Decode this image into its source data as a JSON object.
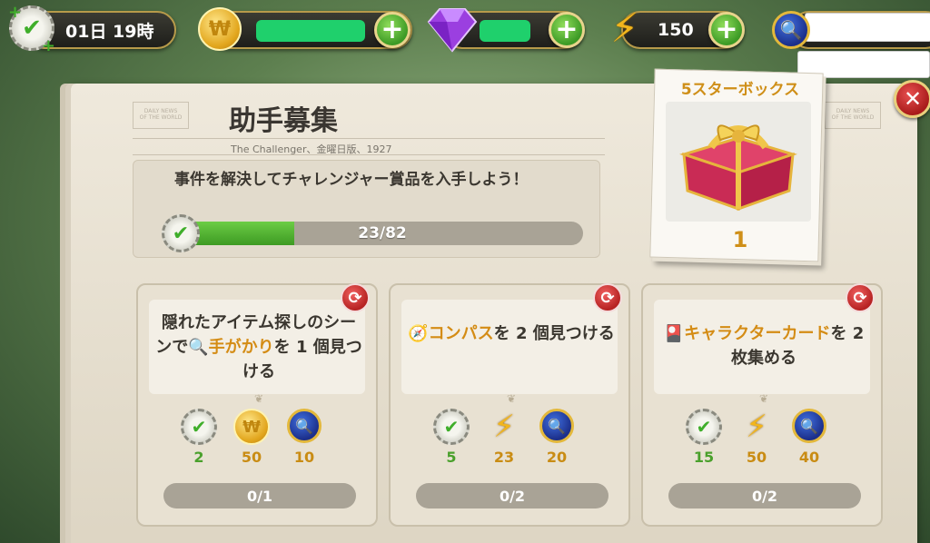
{
  "hud": {
    "timer": "01日 19時",
    "energy": "150",
    "plus_symbol": "+"
  },
  "panel": {
    "title": "助手募集",
    "subtitle": "The Challenger、金曜日版、1927",
    "close_symbol": "✕"
  },
  "progress": {
    "description": "事件を解決してチャレンジャー賞品を入手しよう！",
    "current": 23,
    "total": 82,
    "label": "23/82"
  },
  "reward_box": {
    "title": "5スターボックス",
    "count": "1"
  },
  "tasks": [
    {
      "text_before": "隠れたアイテム探しのシーンで",
      "highlight": "手がかり",
      "text_after": "を 1 個見つける",
      "rewards": [
        {
          "icon": "check-badge-icon",
          "value": "2"
        },
        {
          "icon": "coin-icon",
          "value": "50"
        },
        {
          "icon": "magnifier-badge-icon",
          "value": "10"
        }
      ],
      "progress": "0/1"
    },
    {
      "text_before": "",
      "highlight": "コンパス",
      "text_after": "を 2 個見つける",
      "rewards": [
        {
          "icon": "check-badge-icon",
          "value": "5"
        },
        {
          "icon": "lightning-icon",
          "value": "23"
        },
        {
          "icon": "magnifier-badge-icon",
          "value": "20"
        }
      ],
      "progress": "0/2"
    },
    {
      "text_before": "",
      "highlight": "キャラクターカード",
      "text_after": "を 2 枚集める",
      "rewards": [
        {
          "icon": "check-badge-icon",
          "value": "15"
        },
        {
          "icon": "lightning-icon",
          "value": "50"
        },
        {
          "icon": "magnifier-badge-icon",
          "value": "40"
        }
      ],
      "progress": "0/2"
    }
  ],
  "colors": {
    "accent_gold": "#cf8f18",
    "progress_green": "#4aa02c",
    "button_red": "#b62222",
    "button_green": "#3c9a25"
  }
}
